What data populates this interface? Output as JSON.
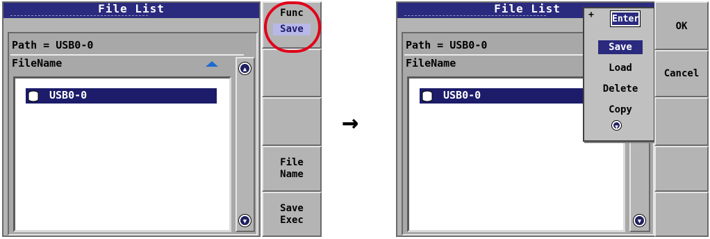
{
  "left": {
    "title": "File List",
    "path": "Path = USB0-0",
    "column_header": "FileName",
    "file_item": "USB0-0",
    "softkeys": {
      "func": "Func",
      "save": "Save",
      "file_name": [
        "File",
        "Name"
      ],
      "save_exec": [
        "Save",
        "Exec"
      ]
    },
    "highlight_color": "#e0001a"
  },
  "arrow": "→",
  "right": {
    "title": "File List",
    "path": "Path = USB0-0",
    "column_header": "FileName",
    "file_item": "USB0-0",
    "popup": {
      "enter_label": "Enter",
      "enter_marker": "+",
      "items": [
        "Save",
        "Load",
        "Delete",
        "Copy"
      ],
      "selected": "Save"
    },
    "softkeys": {
      "ok": "OK",
      "cancel": "Cancel"
    }
  },
  "icons": [
    "drive-icon",
    "scroll-up-icon",
    "scroll-down-icon",
    "sort-ascending-icon"
  ]
}
